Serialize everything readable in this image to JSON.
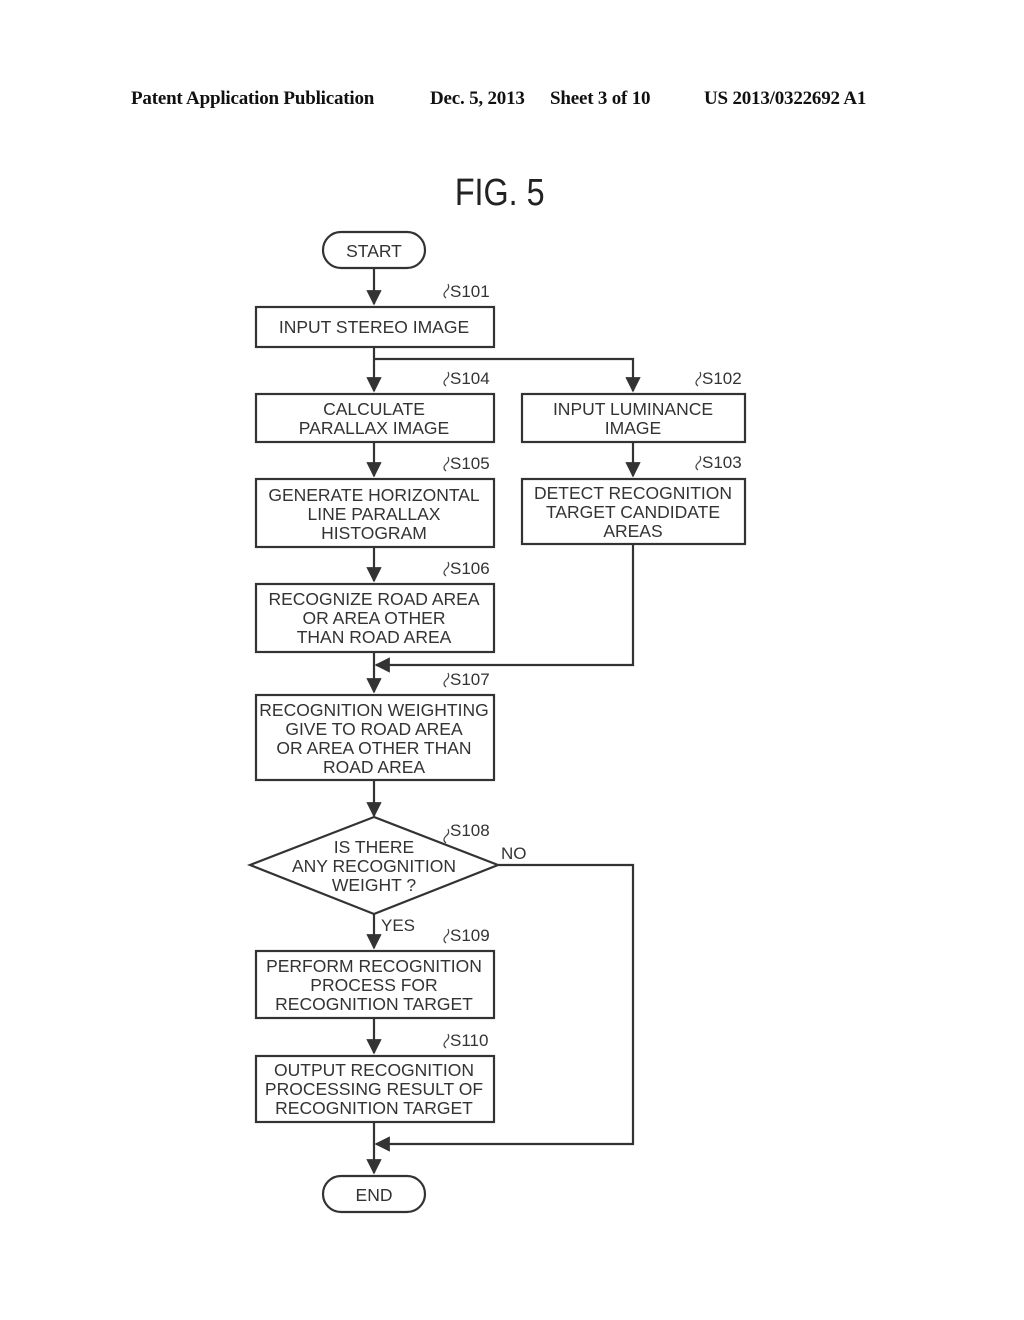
{
  "header": {
    "publication": "Patent Application Publication",
    "date": "Dec. 5, 2013",
    "sheet": "Sheet 3 of 10",
    "number": "US 2013/0322692 A1"
  },
  "figure": {
    "title": "FIG. 5",
    "terminals": {
      "start": "START",
      "end": "END"
    },
    "steps": [
      {
        "id": "S101",
        "lines": [
          "INPUT STEREO IMAGE"
        ]
      },
      {
        "id": "S104",
        "lines": [
          "CALCULATE",
          "PARALLAX IMAGE"
        ]
      },
      {
        "id": "S102",
        "lines": [
          "INPUT LUMINANCE",
          "IMAGE"
        ]
      },
      {
        "id": "S105",
        "lines": [
          "GENERATE HORIZONTAL",
          "LINE PARALLAX",
          "HISTOGRAM"
        ]
      },
      {
        "id": "S103",
        "lines": [
          "DETECT RECOGNITION",
          "TARGET CANDIDATE",
          "AREAS"
        ]
      },
      {
        "id": "S106",
        "lines": [
          "RECOGNIZE ROAD AREA",
          "OR AREA OTHER",
          "THAN ROAD AREA"
        ]
      },
      {
        "id": "S107",
        "lines": [
          "RECOGNITION WEIGHTING",
          "GIVE TO ROAD AREA",
          "OR AREA OTHER THAN",
          "ROAD AREA"
        ]
      },
      {
        "id": "S109",
        "lines": [
          "PERFORM RECOGNITION",
          "PROCESS FOR",
          "RECOGNITION TARGET"
        ]
      },
      {
        "id": "S110",
        "lines": [
          "OUTPUT RECOGNITION",
          "PROCESSING RESULT OF",
          "RECOGNITION TARGET"
        ]
      }
    ],
    "decision": {
      "id": "S108",
      "lines": [
        "IS THERE",
        "ANY RECOGNITION",
        "WEIGHT ?"
      ],
      "yes_label": "YES",
      "no_label": "NO"
    }
  }
}
